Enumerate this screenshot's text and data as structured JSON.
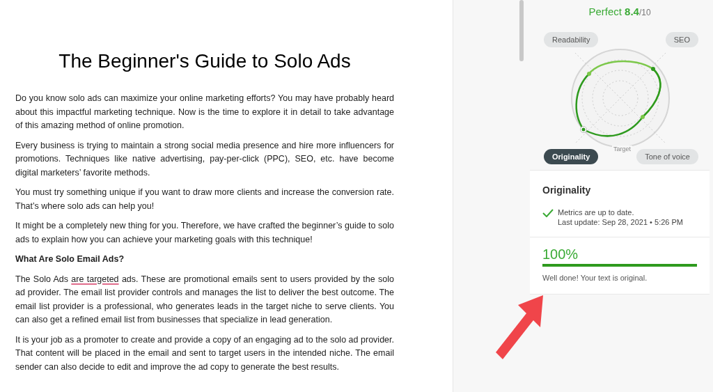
{
  "document": {
    "title": "The Beginner's Guide to Solo Ads",
    "blocks": [
      {
        "kind": "paragraph",
        "segments": [
          {
            "text": "Do you know solo ads can maximize your online marketing efforts? You may have probably heard about this impactful marketing technique. Now is the time to explore it in detail to take advantage of this amazing method of online promotion.",
            "flagged": false
          }
        ]
      },
      {
        "kind": "paragraph",
        "segments": [
          {
            "text": "Every business is trying to maintain a strong social media presence and hire more influencers for promotions. Techniques like native advertising, pay-per-click (PPC), SEO, etc. have become digital marketers’ favorite methods.",
            "flagged": false
          }
        ]
      },
      {
        "kind": "paragraph",
        "segments": [
          {
            "text": "You must try something unique if you want to draw more clients and increase the conversion rate. That’s where solo ads can help you!",
            "flagged": false
          }
        ]
      },
      {
        "kind": "paragraph",
        "segments": [
          {
            "text": "It might be a completely new thing for you. Therefore, we have crafted the beginner’s guide to solo ads to explain how you can achieve your marketing goals with this technique!",
            "flagged": false
          }
        ]
      },
      {
        "kind": "heading",
        "segments": [
          {
            "text": "What Are Solo Email Ads?",
            "flagged": false
          }
        ]
      },
      {
        "kind": "paragraph",
        "segments": [
          {
            "text": "The Solo Ads ",
            "flagged": false
          },
          {
            "text": "are targeted",
            "flagged": true
          },
          {
            "text": " ads. These are promotional emails sent to users provided by the solo ad provider. The email list provider controls and manages the list to deliver the best outcome. The email list provider is a professional, who generates leads in the target niche to serve clients. You can also get a refined email list from businesses that specialize in lead generation.",
            "flagged": false
          }
        ]
      },
      {
        "kind": "paragraph",
        "segments": [
          {
            "text": "It is your job as a promoter to create and provide a copy of an engaging ad to the solo ad provider. That content will be placed in the email and sent to target users in the intended niche. The email sender can also decide to edit and improve the ad copy to generate the best results.",
            "flagged": false
          }
        ]
      }
    ]
  },
  "score": {
    "label": "Perfect",
    "value": "8.4",
    "max": "/10"
  },
  "metrics": [
    {
      "label": "Readability",
      "selected": false
    },
    {
      "label": "SEO",
      "selected": false
    },
    {
      "label": "Originality",
      "selected": true
    },
    {
      "label": "Tone of voice",
      "selected": false
    }
  ],
  "radar": {
    "target_label": "Target"
  },
  "originality": {
    "title": "Originality",
    "status": "Metrics are up to date.",
    "last_update": "Last update: Sep 28, 2021 • 5:26 PM",
    "percent": "100%",
    "level": 1,
    "message": "Well done! Your text is original."
  }
}
